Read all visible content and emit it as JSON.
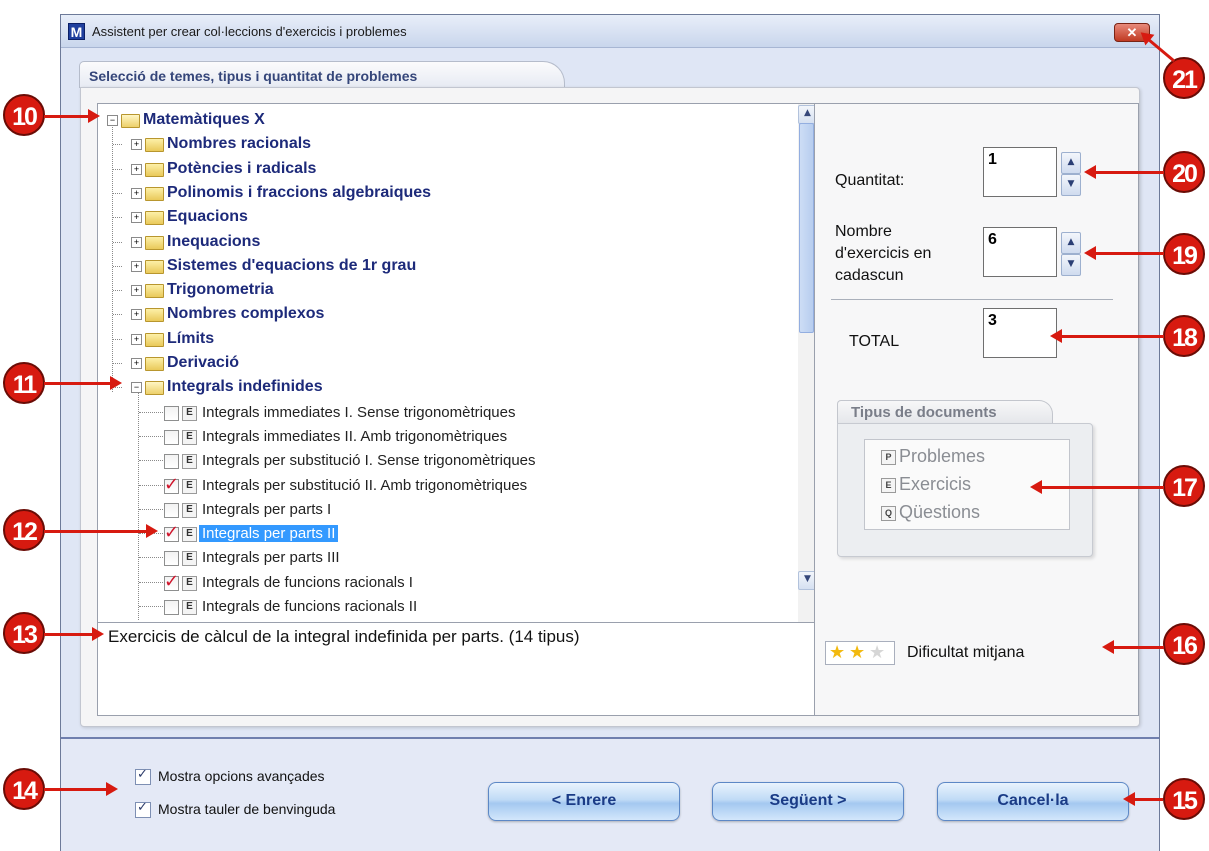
{
  "window": {
    "title": "Assistent per crear col·leccions d'exercicis i problemes",
    "icon_letter": "M",
    "close_glyph": "✕"
  },
  "tab": {
    "label": "Selecció de temes, tipus i quantitat de problemes"
  },
  "tree": {
    "root": "Matemàtiques X",
    "topics": [
      "Nombres racionals",
      "Potències i radicals",
      "Polinomis i fraccions algebraiques",
      "Equacions",
      "Inequacions",
      "Sistemes d'equacions de 1r grau",
      "Trigonometria",
      "Nombres complexos",
      "Límits",
      "Derivació",
      "Integrals indefinides"
    ],
    "expanded_topic_index": 10,
    "exercise_icon": "E",
    "exercises": [
      {
        "label": "Integrals immediates I. Sense trigonomètriques",
        "checked": false,
        "selected": false
      },
      {
        "label": "Integrals immediates II. Amb trigonomètriques",
        "checked": false,
        "selected": false
      },
      {
        "label": "Integrals per substitució I. Sense trigonomètriques",
        "checked": false,
        "selected": false
      },
      {
        "label": "Integrals per substitució II. Amb trigonomètriques",
        "checked": true,
        "selected": false
      },
      {
        "label": "Integrals per parts I",
        "checked": false,
        "selected": false
      },
      {
        "label": "Integrals per parts II",
        "checked": true,
        "selected": true
      },
      {
        "label": "Integrals per parts III",
        "checked": false,
        "selected": false
      },
      {
        "label": "Integrals de funcions racionals I",
        "checked": true,
        "selected": false
      },
      {
        "label": "Integrals de funcions racionals II",
        "checked": false,
        "selected": false
      }
    ]
  },
  "description": "Exercicis de càlcul de la integral indefinida per parts. (14 tipus)",
  "settings": {
    "quantity_label": "Quantitat:",
    "quantity_value": "1",
    "exercises_label_1": "Nombre",
    "exercises_label_2": "d'exercicis en",
    "exercises_label_3": "cadascun",
    "exercises_value": "6",
    "total_label": "TOTAL",
    "total_value": "3",
    "spin_up": "▲",
    "spin_down": "▼"
  },
  "doc_types": {
    "title": "Tipus de documents",
    "items": [
      {
        "icon": "P",
        "label": "Problemes"
      },
      {
        "icon": "E",
        "label": "Exercicis"
      },
      {
        "icon": "Q",
        "label": "Qüestions"
      }
    ]
  },
  "difficulty": {
    "label": "Dificultat mitjana",
    "stars_filled": 2,
    "stars_total": 3,
    "star_color": "#f2b90f"
  },
  "bottom": {
    "advanced_options": "Mostra opcions avançades",
    "welcome_panel": "Mostra tauler de benvinguda",
    "back_button": "< Enrere",
    "next_button": "Següent >",
    "cancel_button": "Cancel·la"
  },
  "annotations": {
    "color": "#d71a10",
    "labels": [
      "10",
      "11",
      "12",
      "13",
      "14",
      "15",
      "16",
      "17",
      "18",
      "19",
      "20",
      "21"
    ]
  }
}
